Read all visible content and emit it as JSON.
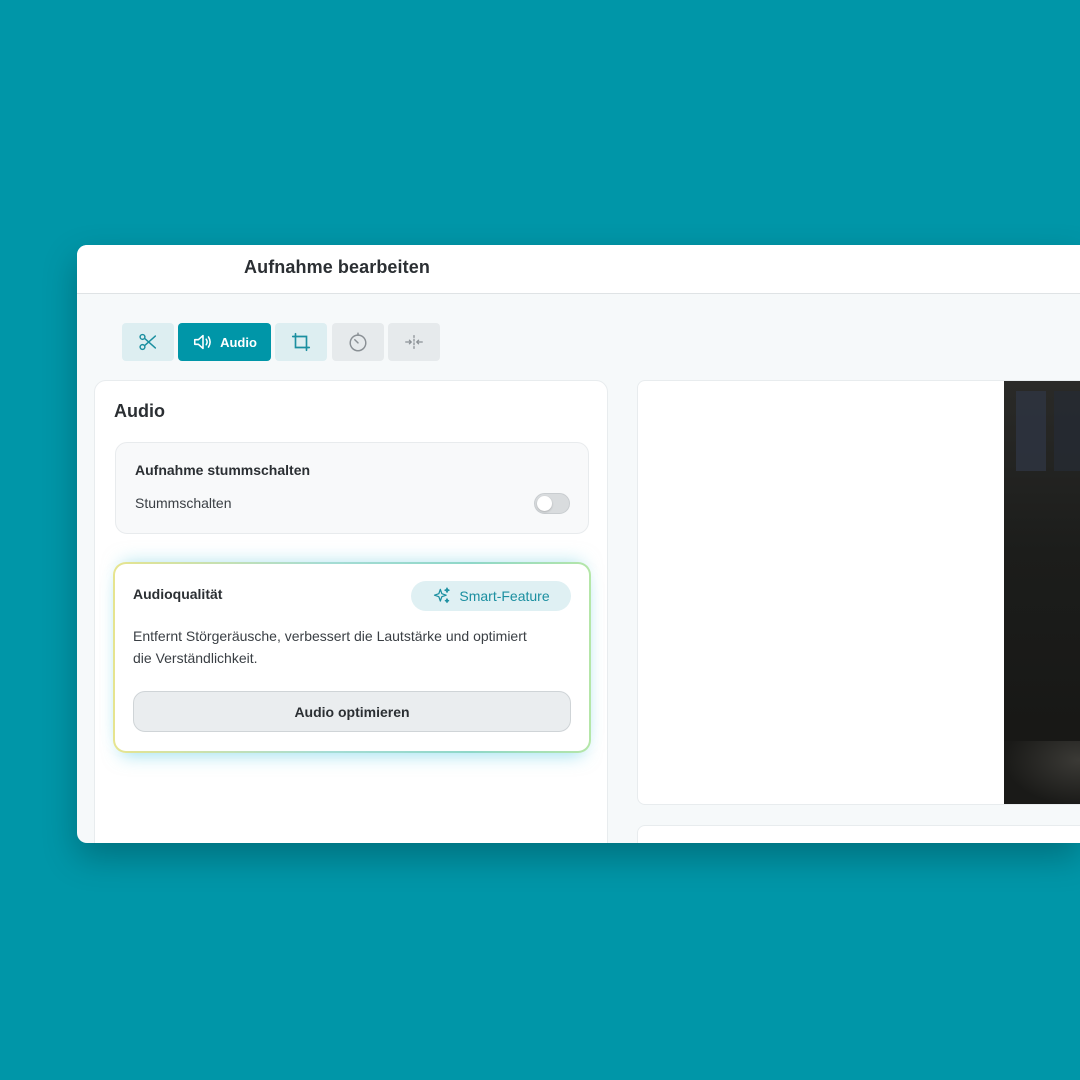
{
  "window": {
    "title": "Aufnahme bearbeiten"
  },
  "toolbar": {
    "tools": [
      {
        "icon": "scissors-icon",
        "label": ""
      },
      {
        "icon": "speaker-icon",
        "label": "Audio",
        "active": true
      },
      {
        "icon": "crop-icon",
        "label": ""
      },
      {
        "icon": "timer-icon",
        "label": ""
      },
      {
        "icon": "merge-icon",
        "label": ""
      }
    ]
  },
  "audio_panel": {
    "title": "Audio",
    "mute_card": {
      "heading": "Aufnahme stummschalten",
      "toggle_label": "Stummschalten",
      "toggle_on": false
    },
    "quality_card": {
      "heading": "Audioqualität",
      "badge": "Smart-Feature",
      "description": "Entfernt Störgeräusche, verbessert die Lautstärke und optimiert die Verständlichkeit.",
      "button": "Audio optimieren"
    }
  },
  "colors": {
    "background": "#0096a8",
    "accent": "#0096a8",
    "badge_text": "#1b8fa0"
  }
}
